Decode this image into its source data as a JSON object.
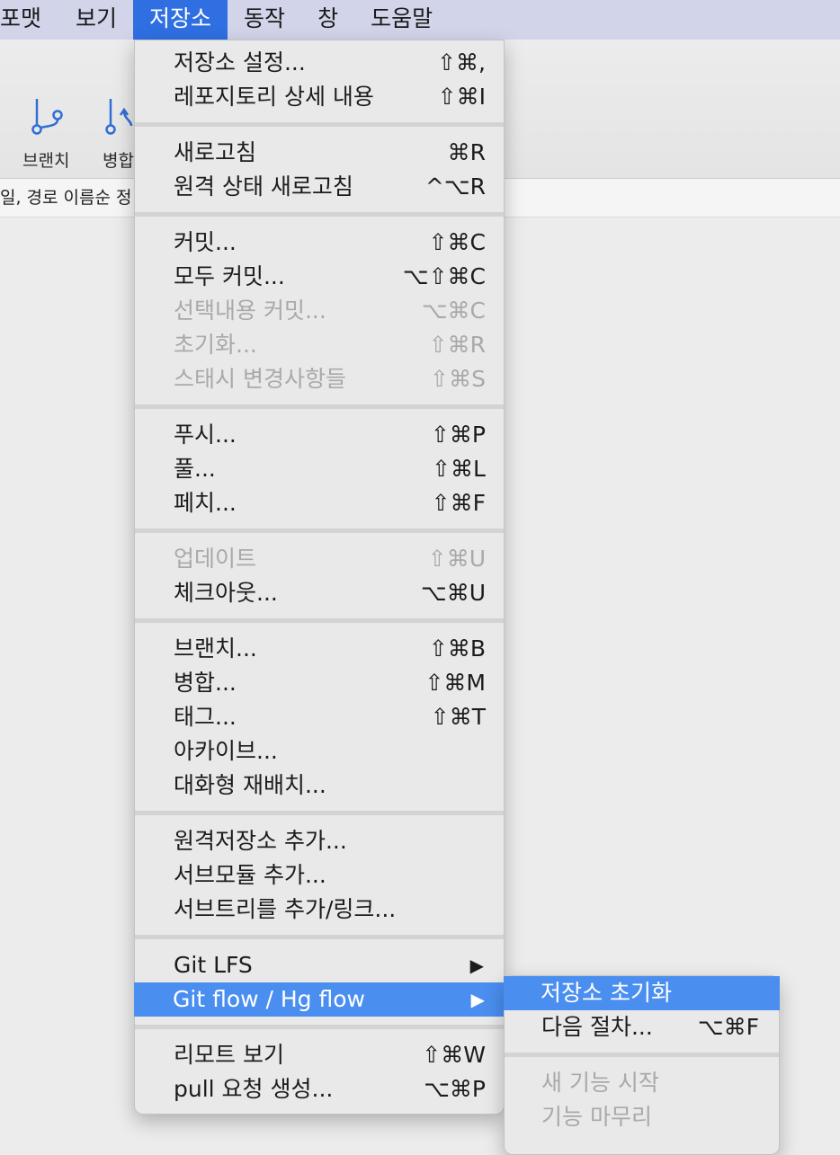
{
  "menubar": {
    "items": [
      "포맷",
      "보기",
      "저장소",
      "동작",
      "창",
      "도움말"
    ],
    "active": "저장소"
  },
  "toolbar": {
    "branch_label": "브랜치",
    "merge_label": "병합"
  },
  "infobar": {
    "text": "일, 경로 이름순 정"
  },
  "main_menu": {
    "groups": [
      [
        {
          "label": "저장소 설정...",
          "shortcut": "⇧⌘,",
          "enabled": true
        },
        {
          "label": "레포지토리 상세 내용",
          "shortcut": "⇧⌘I",
          "enabled": true
        }
      ],
      [
        {
          "label": "새로고침",
          "shortcut": "⌘R",
          "enabled": true
        },
        {
          "label": "원격 상태 새로고침",
          "shortcut": "^⌥R",
          "enabled": true
        }
      ],
      [
        {
          "label": "커밋...",
          "shortcut": "⇧⌘C",
          "enabled": true
        },
        {
          "label": "모두 커밋...",
          "shortcut": "⌥⇧⌘C",
          "enabled": true
        },
        {
          "label": "선택내용 커밋...",
          "shortcut": "⌥⌘C",
          "enabled": false
        },
        {
          "label": "초기화...",
          "shortcut": "⇧⌘R",
          "enabled": false
        },
        {
          "label": "스태시  변경사항들",
          "shortcut": "⇧⌘S",
          "enabled": false
        }
      ],
      [
        {
          "label": "푸시...",
          "shortcut": "⇧⌘P",
          "enabled": true
        },
        {
          "label": "풀...",
          "shortcut": "⇧⌘L",
          "enabled": true
        },
        {
          "label": "페치...",
          "shortcut": "⇧⌘F",
          "enabled": true
        }
      ],
      [
        {
          "label": "업데이트",
          "shortcut": "⇧⌘U",
          "enabled": false
        },
        {
          "label": "체크아웃...",
          "shortcut": "⌥⌘U",
          "enabled": true
        }
      ],
      [
        {
          "label": "브랜치...",
          "shortcut": "⇧⌘B",
          "enabled": true
        },
        {
          "label": "병합...",
          "shortcut": "⇧⌘M",
          "enabled": true
        },
        {
          "label": "태그...",
          "shortcut": "⇧⌘T",
          "enabled": true
        },
        {
          "label": "아카이브...",
          "shortcut": "",
          "enabled": true
        },
        {
          "label": "대화형 재배치...",
          "shortcut": "",
          "enabled": true
        }
      ],
      [
        {
          "label": "원격저장소 추가...",
          "shortcut": "",
          "enabled": true
        },
        {
          "label": "서브모듈 추가...",
          "shortcut": "",
          "enabled": true
        },
        {
          "label": "서브트리를 추가/링크...",
          "shortcut": "",
          "enabled": true
        }
      ],
      [
        {
          "label": "Git LFS",
          "shortcut": "",
          "enabled": true,
          "submenu": true
        },
        {
          "label": "Git flow / Hg flow",
          "shortcut": "",
          "enabled": true,
          "submenu": true,
          "highlighted": true
        }
      ],
      [
        {
          "label": "리모트 보기",
          "shortcut": "⇧⌘W",
          "enabled": true
        },
        {
          "label": "pull 요청 생성...",
          "shortcut": "⌥⌘P",
          "enabled": true
        }
      ]
    ],
    "submenu_arrow": "▶"
  },
  "sub_menu": {
    "groups": [
      [
        {
          "label": "저장소 초기화",
          "shortcut": "",
          "enabled": true,
          "highlighted": true
        },
        {
          "label": "다음 절차...",
          "shortcut": "⌥⌘F",
          "enabled": true
        }
      ],
      [
        {
          "label": "새 기능 시작",
          "shortcut": "",
          "enabled": false
        },
        {
          "label": "기능 마무리",
          "shortcut": "",
          "enabled": false
        }
      ]
    ]
  },
  "colors": {
    "menubar_bg": "#d2d4ea",
    "active_menu": "#2f6fe2",
    "highlight": "#4a8ef0",
    "icon_blue": "#2f6fd6",
    "disabled_text": "#a9a9a9"
  },
  "icons": [
    "branch-icon",
    "merge-icon"
  ]
}
